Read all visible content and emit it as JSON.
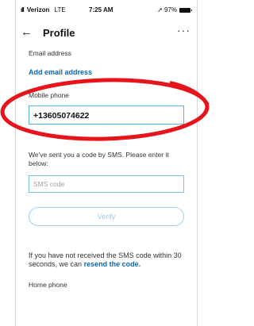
{
  "status_bar": {
    "signal_icon": "signal-bars-icon",
    "carrier": "Verizon",
    "network": "LTE",
    "time": "7:25 AM",
    "location_icon": "location-arrow-icon",
    "battery": "97%",
    "battery_icon": "battery-icon"
  },
  "nav": {
    "back_icon": "back-arrow-icon",
    "back_glyph": "←",
    "title": "Profile",
    "more_glyph": "···"
  },
  "email": {
    "label": "Email address",
    "add_link": "Add email address"
  },
  "mobile": {
    "label": "Mobile phone",
    "value": "+13605074622"
  },
  "sms": {
    "instructions": "We've sent you a code by SMS. Please enter it below:",
    "placeholder": "SMS code",
    "verify_label": "Verify",
    "not_received_text": "If you have not received the SMS code within 30 seconds, we can",
    "resend_link": "resend the code."
  },
  "home_phone": {
    "label": "Home phone"
  },
  "colors": {
    "link": "#0a66b2",
    "field_border": "#5ab4e6",
    "annotation": "#e8141c"
  }
}
